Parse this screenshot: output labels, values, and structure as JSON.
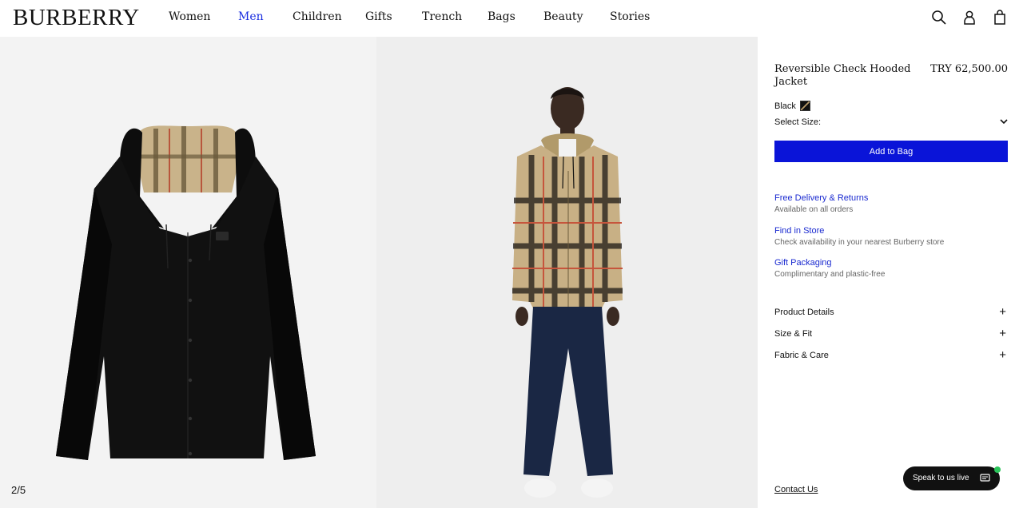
{
  "brand": "BURBERRY",
  "nav": [
    "Women",
    "Men",
    "Children",
    "Gifts",
    "Trench",
    "Bags",
    "Beauty",
    "Stories"
  ],
  "active_nav": "Men",
  "header_icons": [
    "search-icon",
    "account-icon",
    "bag-icon"
  ],
  "gallery": {
    "counter": "2/5"
  },
  "product": {
    "title": "Reversible Check Hooded Jacket",
    "price": "TRY 62,500.00",
    "color_label": "Black",
    "size_label": "Select Size:",
    "add_to_bag": "Add to Bag"
  },
  "services": [
    {
      "title": "Free Delivery & Returns",
      "desc": "Available on all orders"
    },
    {
      "title": "Find in Store",
      "desc": "Check availability in your nearest Burberry store"
    },
    {
      "title": "Gift Packaging",
      "desc": "Complimentary and plastic-free"
    }
  ],
  "accordion": [
    "Product Details",
    "Size & Fit",
    "Fabric & Care"
  ],
  "contact": "Contact Us",
  "chat": "Speak to us live",
  "colors": {
    "accent": "#0a14d8",
    "link": "#1a2ad0",
    "active_nav": "#1a2ee0",
    "chat_bg": "#111111",
    "online": "#2bc45a"
  }
}
